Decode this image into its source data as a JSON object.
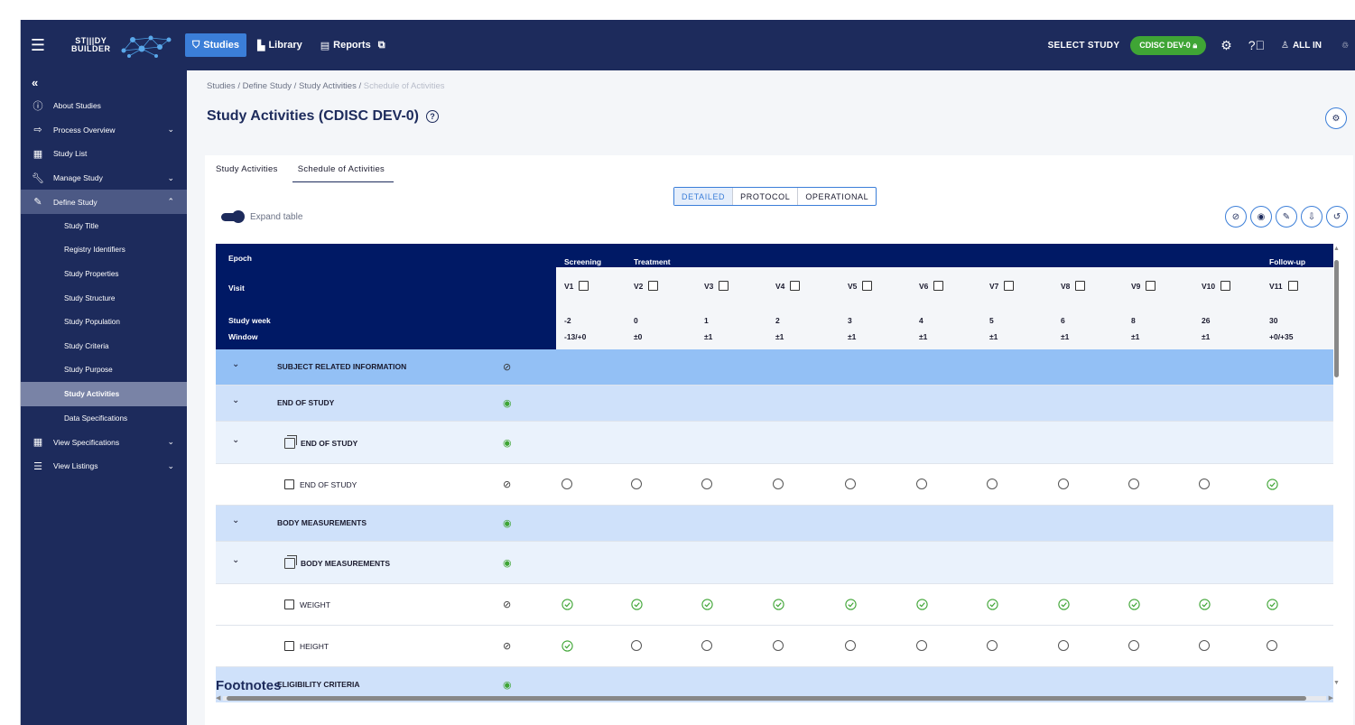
{
  "topbar": {
    "logo_line1": "ST|||DY",
    "logo_line2": "BUILDER",
    "nav": [
      {
        "label": "Studies",
        "icon": "studies-icon",
        "active": true
      },
      {
        "label": "Library",
        "icon": "library-icon",
        "active": false
      },
      {
        "label": "Reports",
        "icon": "reports-icon",
        "active": false
      }
    ],
    "select_study_label": "SELECT STUDY",
    "study_badge": "CDISC DEV-0",
    "user_label": "ALL IN"
  },
  "sidebar": {
    "items": [
      {
        "label": "About Studies",
        "icon": "info-icon"
      },
      {
        "label": "Process Overview",
        "icon": "arrow-right-icon",
        "chevron": true
      },
      {
        "label": "Study List",
        "icon": "table-icon"
      },
      {
        "label": "Manage Study",
        "icon": "wrench-icon",
        "chevron": true
      },
      {
        "label": "Define Study",
        "icon": "edit-document-icon",
        "chevron": true,
        "open": true
      }
    ],
    "define_study_sub": [
      "Study Title",
      "Registry Identifiers",
      "Study Properties",
      "Study Structure",
      "Study Population",
      "Study Criteria",
      "Study Purpose",
      "Study Activities",
      "Data Specifications"
    ],
    "bottom_items": [
      {
        "label": "View Specifications",
        "icon": "grid-icon"
      },
      {
        "label": "View Listings",
        "icon": "list-icon"
      }
    ]
  },
  "breadcrumb": {
    "items": [
      "Studies",
      "Define Study",
      "Study Activities"
    ],
    "current": "Schedule of Activities"
  },
  "page_title": "Study Activities (CDISC DEV-0)",
  "tabs": [
    "Study Activities",
    "Schedule of Activities"
  ],
  "view_modes": [
    "DETAILED",
    "PROTOCOL",
    "OPERATIONAL"
  ],
  "expand_table_label": "Expand table",
  "table": {
    "header_labels": {
      "epoch": "Epoch",
      "visit": "Visit",
      "study_week": "Study week",
      "window": "Window"
    },
    "epochs": [
      {
        "label": "Screening",
        "col": 0
      },
      {
        "label": "Treatment",
        "col": 1
      },
      {
        "label": "Follow-up",
        "col": 10
      }
    ],
    "visits": [
      "V1",
      "V2",
      "V3",
      "V4",
      "V5",
      "V6",
      "V7",
      "V8",
      "V9",
      "V10",
      "V11"
    ],
    "study_weeks": [
      "-2",
      "0",
      "1",
      "2",
      "3",
      "4",
      "5",
      "6",
      "8",
      "26",
      "30"
    ],
    "windows": [
      "-13/+0",
      "±0",
      "±1",
      "±1",
      "±1",
      "±1",
      "±1",
      "±1",
      "±1",
      "±1",
      "+0/+35"
    ],
    "rows": [
      {
        "type": "group",
        "label": "SUBJECT RELATED INFORMATION",
        "visible": false
      },
      {
        "type": "subgroup",
        "label": "END OF STUDY",
        "visible": true
      },
      {
        "type": "activitygroup",
        "label": "END OF STUDY",
        "visible": true
      },
      {
        "type": "activity",
        "label": "END OF STUDY",
        "visible": false,
        "cells": [
          0,
          0,
          0,
          0,
          0,
          0,
          0,
          0,
          0,
          0,
          1
        ]
      },
      {
        "type": "subgroup",
        "label": "BODY MEASUREMENTS",
        "visible": true
      },
      {
        "type": "activitygroup",
        "label": "BODY MEASUREMENTS",
        "visible": true
      },
      {
        "type": "activity",
        "label": "WEIGHT",
        "visible": false,
        "cells": [
          1,
          1,
          1,
          1,
          1,
          1,
          1,
          1,
          1,
          1,
          1
        ]
      },
      {
        "type": "activity",
        "label": "HEIGHT",
        "visible": false,
        "cells": [
          1,
          0,
          0,
          0,
          0,
          0,
          0,
          0,
          0,
          0,
          0
        ]
      },
      {
        "type": "subgroup",
        "label": "ELIGIBILITY CRITERIA",
        "visible": true
      }
    ]
  },
  "footnotes_title": "Footnotes"
}
